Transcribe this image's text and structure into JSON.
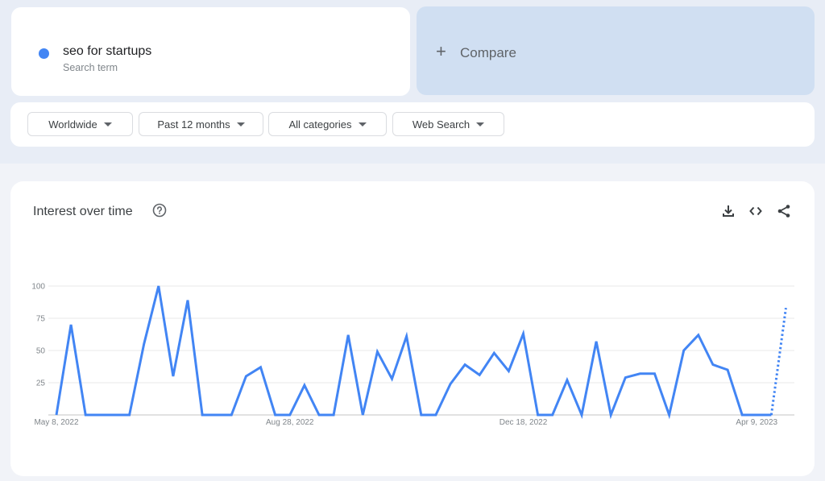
{
  "search_term": {
    "name": "seo for startups",
    "subtitle": "Search term",
    "color": "#4285f4"
  },
  "compare": {
    "icon": "plus-icon",
    "label": "Compare"
  },
  "filters": [
    {
      "label": "Worldwide"
    },
    {
      "label": "Past 12 months"
    },
    {
      "label": "All categories"
    },
    {
      "label": "Web Search"
    }
  ],
  "panel": {
    "title": "Interest over time",
    "help_icon": "help-circle-icon",
    "tools": [
      "download-icon",
      "embed-code-icon",
      "share-icon"
    ]
  },
  "chart_data": {
    "type": "line",
    "title": "Interest over time",
    "xlabel": "",
    "ylabel": "",
    "ylim": [
      0,
      100
    ],
    "yticks": [
      25,
      50,
      75,
      100
    ],
    "xtick_labels": [
      {
        "index": 0,
        "label": "May 8, 2022"
      },
      {
        "index": 16,
        "label": "Aug 28, 2022"
      },
      {
        "index": 32,
        "label": "Dec 18, 2022"
      },
      {
        "index": 48,
        "label": "Apr 9, 2023"
      }
    ],
    "grid": true,
    "series": [
      {
        "name": "seo for startups",
        "color": "#4285f4",
        "values": [
          0,
          70,
          0,
          0,
          0,
          0,
          55,
          100,
          30,
          89,
          0,
          0,
          0,
          30,
          37,
          0,
          0,
          23,
          0,
          0,
          62,
          0,
          49,
          28,
          61,
          0,
          0,
          24,
          39,
          31,
          48,
          34,
          63,
          0,
          0,
          27,
          0,
          57,
          0,
          29,
          32,
          32,
          0,
          50,
          62,
          39,
          35,
          0,
          0,
          0,
          83
        ],
        "partial_last_point": true
      }
    ]
  }
}
